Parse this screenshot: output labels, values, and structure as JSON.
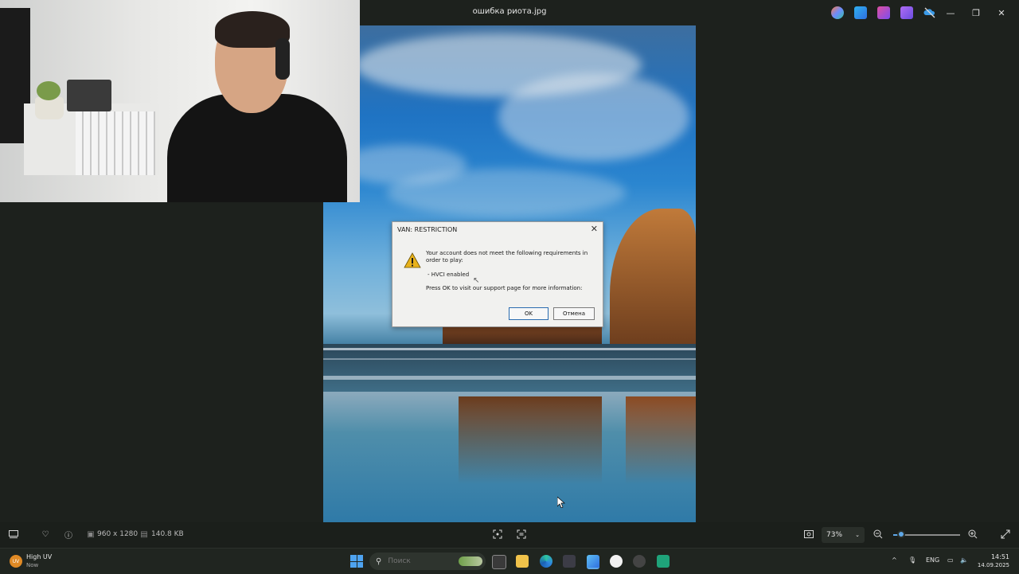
{
  "window": {
    "title": "ошибка риота.jpg",
    "controls": {
      "minimize": "—",
      "maximize": "❐",
      "close": "✕"
    }
  },
  "titlebar_icons": [
    {
      "name": "copilot-icon",
      "color": "#6b8cff"
    },
    {
      "name": "photos-edit-icon",
      "color": "#2f86e0"
    },
    {
      "name": "clipchamp-icon",
      "color": "#b05ae0"
    },
    {
      "name": "designer-icon",
      "color": "#8a5cf0"
    },
    {
      "name": "onedrive-off-icon",
      "color": "#3b9be8"
    }
  ],
  "dialog": {
    "title": "VAN: RESTRICTION",
    "close": "✕",
    "message": "Your account does not meet the following requirements in order to play:",
    "requirement": "- HVCI enabled",
    "instruction": "Press OK to visit our support page for more information:",
    "ok_label": "OK",
    "cancel_label": "Отмена"
  },
  "toolbar": {
    "dimensions": "960 x 1280",
    "file_size": "140.8 KB",
    "zoom": "73%"
  },
  "taskbar": {
    "weather_badge": "UV",
    "weather_title": "High UV",
    "weather_sub": "Now",
    "search_placeholder": "Поиск",
    "language": "ENG",
    "time": "14:51",
    "date": "14.09.2025"
  },
  "colors": {
    "accent": "#5fa8e8",
    "background": "#1d211d"
  }
}
